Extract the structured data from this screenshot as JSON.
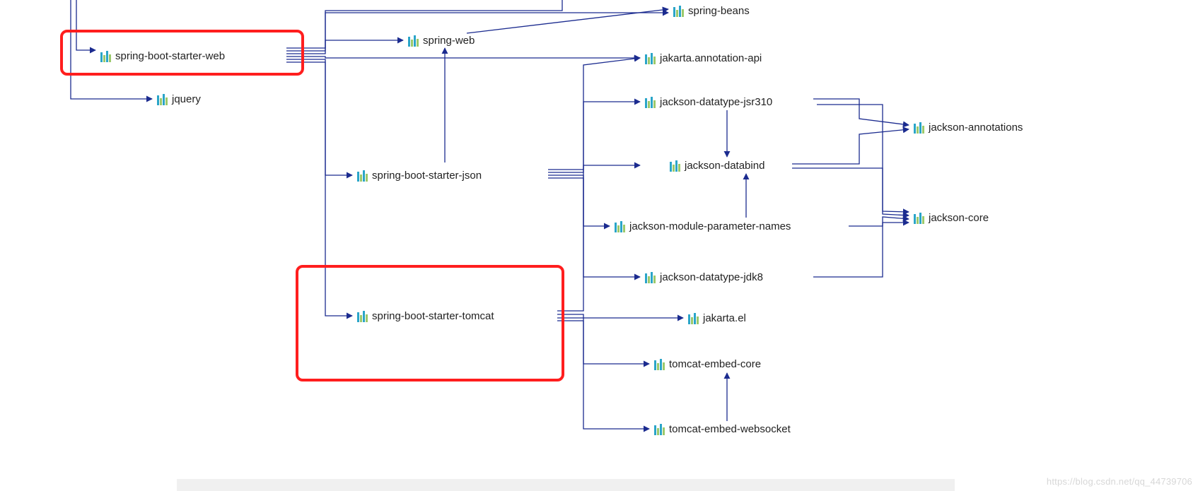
{
  "nodes": {
    "starterWeb": "spring-boot-starter-web",
    "jquery": "jquery",
    "springWeb": "spring-web",
    "starterJson": "spring-boot-starter-json",
    "starterTomcat": "spring-boot-starter-tomcat",
    "springBeans": "spring-beans",
    "jakartaAnnotation": "jakarta.annotation-api",
    "jacksonJsr310": "jackson-datatype-jsr310",
    "jacksonDatabind": "jackson-databind",
    "jacksonParamNames": "jackson-module-parameter-names",
    "jacksonJdk8": "jackson-datatype-jdk8",
    "jakartaEl": "jakarta.el",
    "tomcatCore": "tomcat-embed-core",
    "tomcatWebsocket": "tomcat-embed-websocket",
    "jacksonAnnotations": "jackson-annotations",
    "jacksonCore": "jackson-core"
  },
  "watermark": "https://blog.csdn.net/qq_44739706",
  "chart_data": {
    "type": "dependency-graph",
    "title": "",
    "highlighted": [
      "spring-boot-starter-web",
      "spring-boot-starter-tomcat"
    ],
    "edges": [
      {
        "from": "(root)",
        "to": "spring-boot-starter-web"
      },
      {
        "from": "(root)",
        "to": "jquery"
      },
      {
        "from": "spring-boot-starter-web",
        "to": "spring-web"
      },
      {
        "from": "spring-boot-starter-web",
        "to": "spring-boot-starter-json"
      },
      {
        "from": "spring-boot-starter-web",
        "to": "spring-boot-starter-tomcat"
      },
      {
        "from": "spring-boot-starter-web",
        "to": "spring-beans"
      },
      {
        "from": "spring-boot-starter-web",
        "to": "jakarta.annotation-api"
      },
      {
        "from": "spring-web",
        "to": "spring-beans"
      },
      {
        "from": "spring-boot-starter-json",
        "to": "spring-web"
      },
      {
        "from": "spring-boot-starter-json",
        "to": "jackson-datatype-jsr310"
      },
      {
        "from": "spring-boot-starter-json",
        "to": "jackson-databind"
      },
      {
        "from": "spring-boot-starter-json",
        "to": "jackson-module-parameter-names"
      },
      {
        "from": "spring-boot-starter-json",
        "to": "jackson-datatype-jdk8"
      },
      {
        "from": "spring-boot-starter-tomcat",
        "to": "jakarta.annotation-api"
      },
      {
        "from": "spring-boot-starter-tomcat",
        "to": "jakarta.el"
      },
      {
        "from": "spring-boot-starter-tomcat",
        "to": "tomcat-embed-core"
      },
      {
        "from": "spring-boot-starter-tomcat",
        "to": "tomcat-embed-websocket"
      },
      {
        "from": "jackson-datatype-jsr310",
        "to": "jackson-annotations"
      },
      {
        "from": "jackson-datatype-jsr310",
        "to": "jackson-databind"
      },
      {
        "from": "jackson-datatype-jsr310",
        "to": "jackson-core"
      },
      {
        "from": "jackson-databind",
        "to": "jackson-annotations"
      },
      {
        "from": "jackson-databind",
        "to": "jackson-core"
      },
      {
        "from": "jackson-module-parameter-names",
        "to": "jackson-databind"
      },
      {
        "from": "jackson-module-parameter-names",
        "to": "jackson-core"
      },
      {
        "from": "jackson-datatype-jdk8",
        "to": "jackson-core"
      },
      {
        "from": "tomcat-embed-websocket",
        "to": "tomcat-embed-core"
      }
    ]
  }
}
